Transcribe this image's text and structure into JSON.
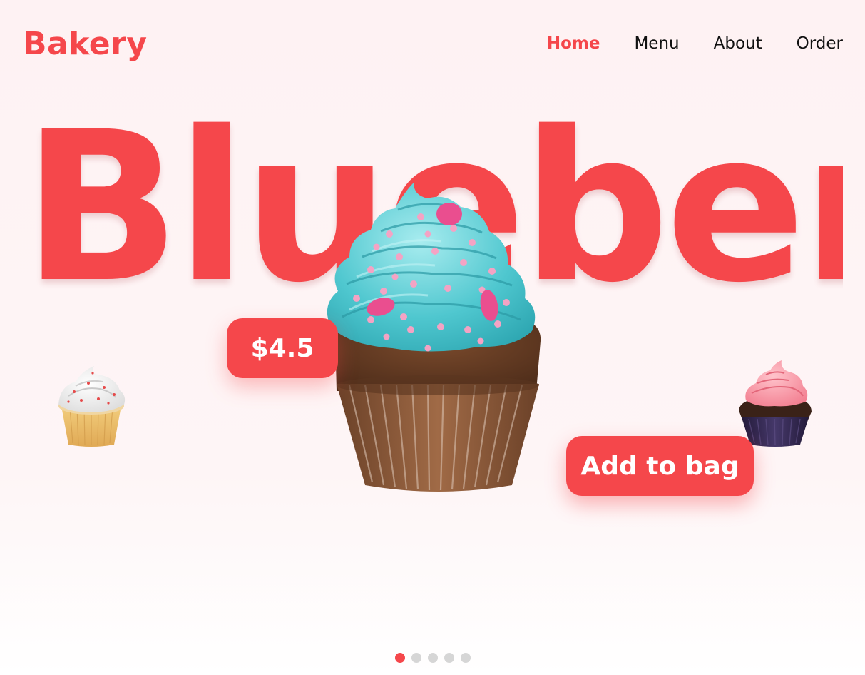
{
  "brand": {
    "logo": "Bakery",
    "accent_color": "#f5474b"
  },
  "nav": {
    "items": [
      {
        "label": "Home",
        "active": true
      },
      {
        "label": "Menu",
        "active": false
      },
      {
        "label": "About",
        "active": false
      },
      {
        "label": "Order",
        "active": false
      }
    ]
  },
  "hero": {
    "title": "Blueberry",
    "price": "$4.5",
    "add_to_bag_label": "Add to bag",
    "main_image": "blueberry-cupcake",
    "left_image": "vanilla-cupcake",
    "right_image": "strawberry-cupcake"
  },
  "carousel": {
    "total_slides": 5,
    "active_index": 0
  }
}
